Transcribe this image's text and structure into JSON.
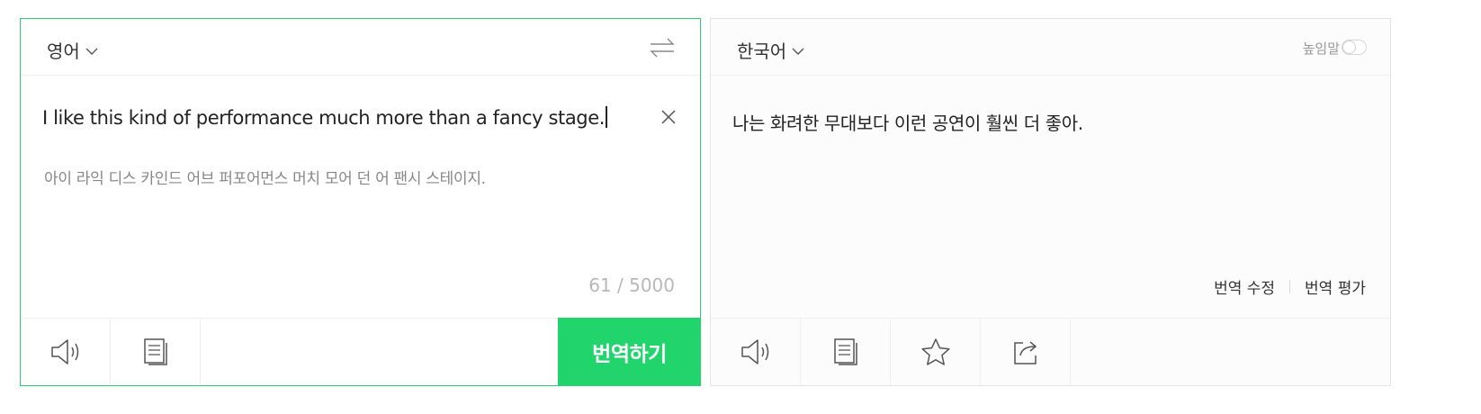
{
  "source": {
    "language": "영어",
    "text": "I like this kind of performance much more than a fancy stage.",
    "pronunciation": "아이 라익 디스 카인드 어브 퍼포어먼스 머치 모어 던 어 팬시 스테이지.",
    "char_count": "61 / 5000",
    "translate_button": "번역하기",
    "icons": {
      "swap": "swap-arrows-icon",
      "clear": "close-icon",
      "listen": "speaker-icon",
      "copy": "copy-icon"
    }
  },
  "target": {
    "language": "한국어",
    "honorific_label": "높임말",
    "honorific_on": false,
    "text": "나는 화려한 무대보다 이런 공연이 훨씬 더 좋아.",
    "edit_link": "번역 수정",
    "rate_link": "번역 평가",
    "icons": {
      "listen": "speaker-icon",
      "copy": "copy-icon",
      "favorite": "star-icon",
      "share": "share-icon"
    }
  },
  "colors": {
    "accent": "#22d46c",
    "accent_border": "#2fce6e"
  }
}
